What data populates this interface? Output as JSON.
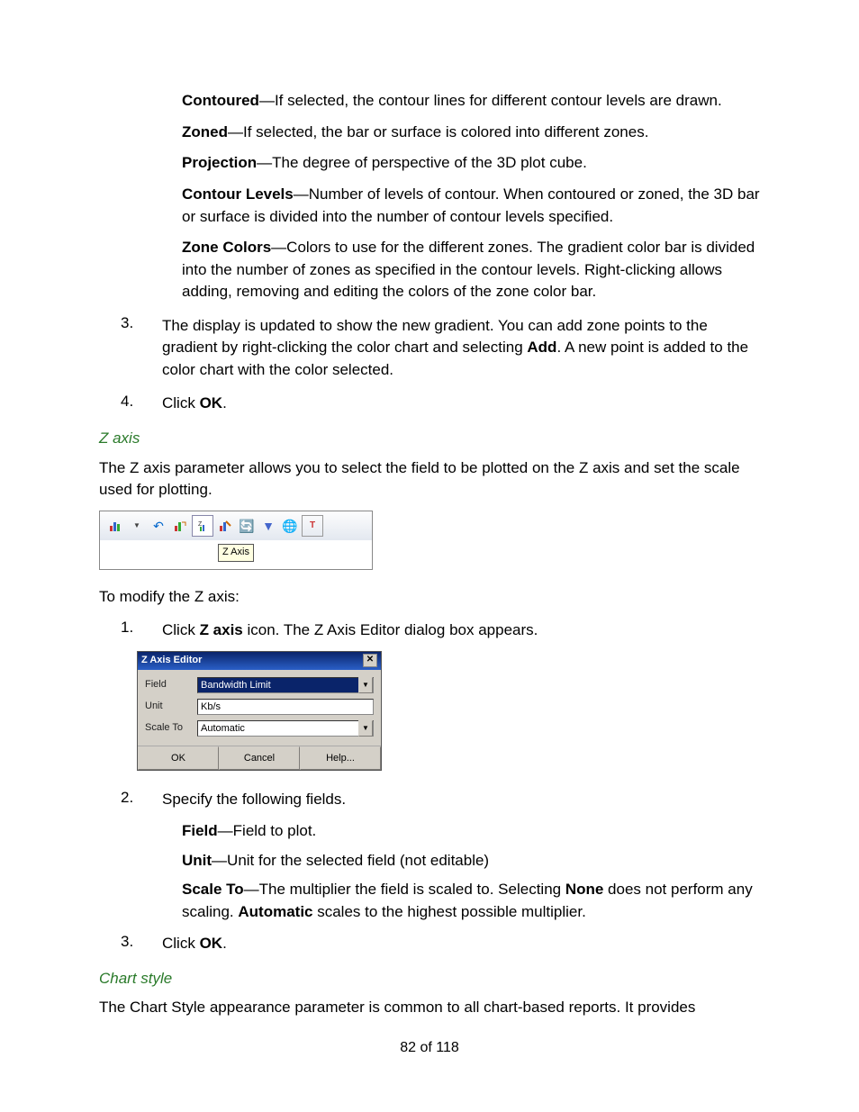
{
  "defs": {
    "contoured_label": "Contoured",
    "contoured_text": "—If selected, the contour lines for different contour levels are drawn.",
    "zoned_label": "Zoned",
    "zoned_text": "—If selected, the bar or surface is colored into different zones.",
    "projection_label": "Projection",
    "projection_text": "—The degree of perspective of the 3D plot cube.",
    "contourlevels_label": "Contour Levels",
    "contourlevels_text": "—Number of levels of contour. When contoured or zoned, the 3D bar or surface is divided into the number of contour levels specified.",
    "zonecolors_label": "Zone Colors",
    "zonecolors_text": "—Colors to use for the different zones. The gradient color bar is divided into the number of zones as specified in the contour levels. Right-clicking allows adding, removing and editing the colors of the zone color bar."
  },
  "step3": {
    "num": "3.",
    "text_a": "The display is updated to show the new gradient. You can add zone points to the gradient by right-clicking the color chart and selecting ",
    "bold": "Add",
    "text_b": ". A new point is added to the color chart with the color selected."
  },
  "step4": {
    "num": "4.",
    "text_a": "Click ",
    "bold": "OK",
    "text_b": "."
  },
  "zaxis": {
    "heading": "Z axis",
    "intro": "The Z axis parameter allows you to select the field to be plotted on the Z axis and set the scale used for plotting.",
    "tooltip": "Z Axis",
    "modify": "To modify the Z axis:",
    "s1": {
      "num": "1.",
      "text_a": "Click ",
      "bold": "Z axis",
      "text_b": " icon. The Z Axis Editor dialog box appears."
    },
    "dialog": {
      "title": "Z Axis Editor",
      "field_label": "Field",
      "field_value": "Bandwidth Limit",
      "unit_label": "Unit",
      "unit_value": "Kb/s",
      "scale_label": "Scale To",
      "scale_value": "Automatic",
      "ok": "OK",
      "cancel": "Cancel",
      "help": "Help..."
    },
    "s2": {
      "num": "2.",
      "text": "Specify the following fields.",
      "field_label": "Field",
      "field_text": "—Field to plot.",
      "unit_label": "Unit",
      "unit_text": "—Unit for the selected field (not editable)",
      "scale_label": "Scale To",
      "scale_text_a": "—The multiplier the field is scaled to. Selecting ",
      "scale_bold1": "None",
      "scale_text_b": " does not perform any scaling. ",
      "scale_bold2": "Automatic",
      "scale_text_c": " scales to the highest possible multiplier."
    },
    "s3": {
      "num": "3.",
      "text_a": "Click ",
      "bold": "OK",
      "text_b": "."
    }
  },
  "chartstyle": {
    "heading": "Chart style",
    "intro": "The Chart Style appearance parameter is common to all chart-based reports. It provides"
  },
  "pagenum": "82 of 118"
}
